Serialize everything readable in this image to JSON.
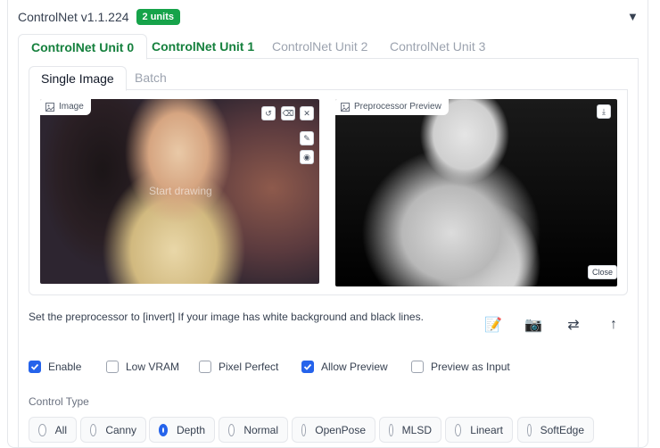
{
  "header": {
    "title": "ControlNet v1.1.224",
    "badge": "2 units",
    "collapse_icon": "triangle-down-icon"
  },
  "unit_tabs": [
    {
      "label": "ControlNet Unit 0",
      "state": "active"
    },
    {
      "label": "ControlNet Unit 1",
      "state": "configured"
    },
    {
      "label": "ControlNet Unit 2",
      "state": "inactive"
    },
    {
      "label": "ControlNet Unit 3",
      "state": "inactive"
    }
  ],
  "image_tabs": [
    {
      "label": "Single Image",
      "state": "active"
    },
    {
      "label": "Batch",
      "state": "inactive"
    }
  ],
  "image_panel": {
    "label": "Image",
    "watermark": "Start drawing",
    "tools": [
      "undo-icon",
      "clear-icon",
      "close-icon",
      "brush-icon",
      "palette-icon"
    ]
  },
  "preview_panel": {
    "label": "Preprocessor Preview",
    "close_label": "Close",
    "tools": [
      "download-icon"
    ]
  },
  "hint_text": "Set the preprocessor to [invert] If your image has white background and black lines.",
  "actions": [
    {
      "icon": "memo-icon",
      "glyph": "📝"
    },
    {
      "icon": "camera-icon",
      "glyph": "📷"
    },
    {
      "icon": "swap-icon",
      "glyph": "⇄"
    },
    {
      "icon": "arrow-up-icon",
      "glyph": "↑"
    }
  ],
  "checkboxes": [
    {
      "label": "Enable",
      "checked": true
    },
    {
      "label": "Low VRAM",
      "checked": false
    },
    {
      "label": "Pixel Perfect",
      "checked": false
    },
    {
      "label": "Allow Preview",
      "checked": true
    },
    {
      "label": "Preview as Input",
      "checked": false
    }
  ],
  "control_type": {
    "label": "Control Type",
    "options": [
      "All",
      "Canny",
      "Depth",
      "Normal",
      "OpenPose",
      "MLSD",
      "Lineart",
      "SoftEdge"
    ],
    "selected": "Depth"
  },
  "colors": {
    "accent_green": "#15803d",
    "badge_green": "#16a34a",
    "accent_blue": "#2563eb"
  }
}
